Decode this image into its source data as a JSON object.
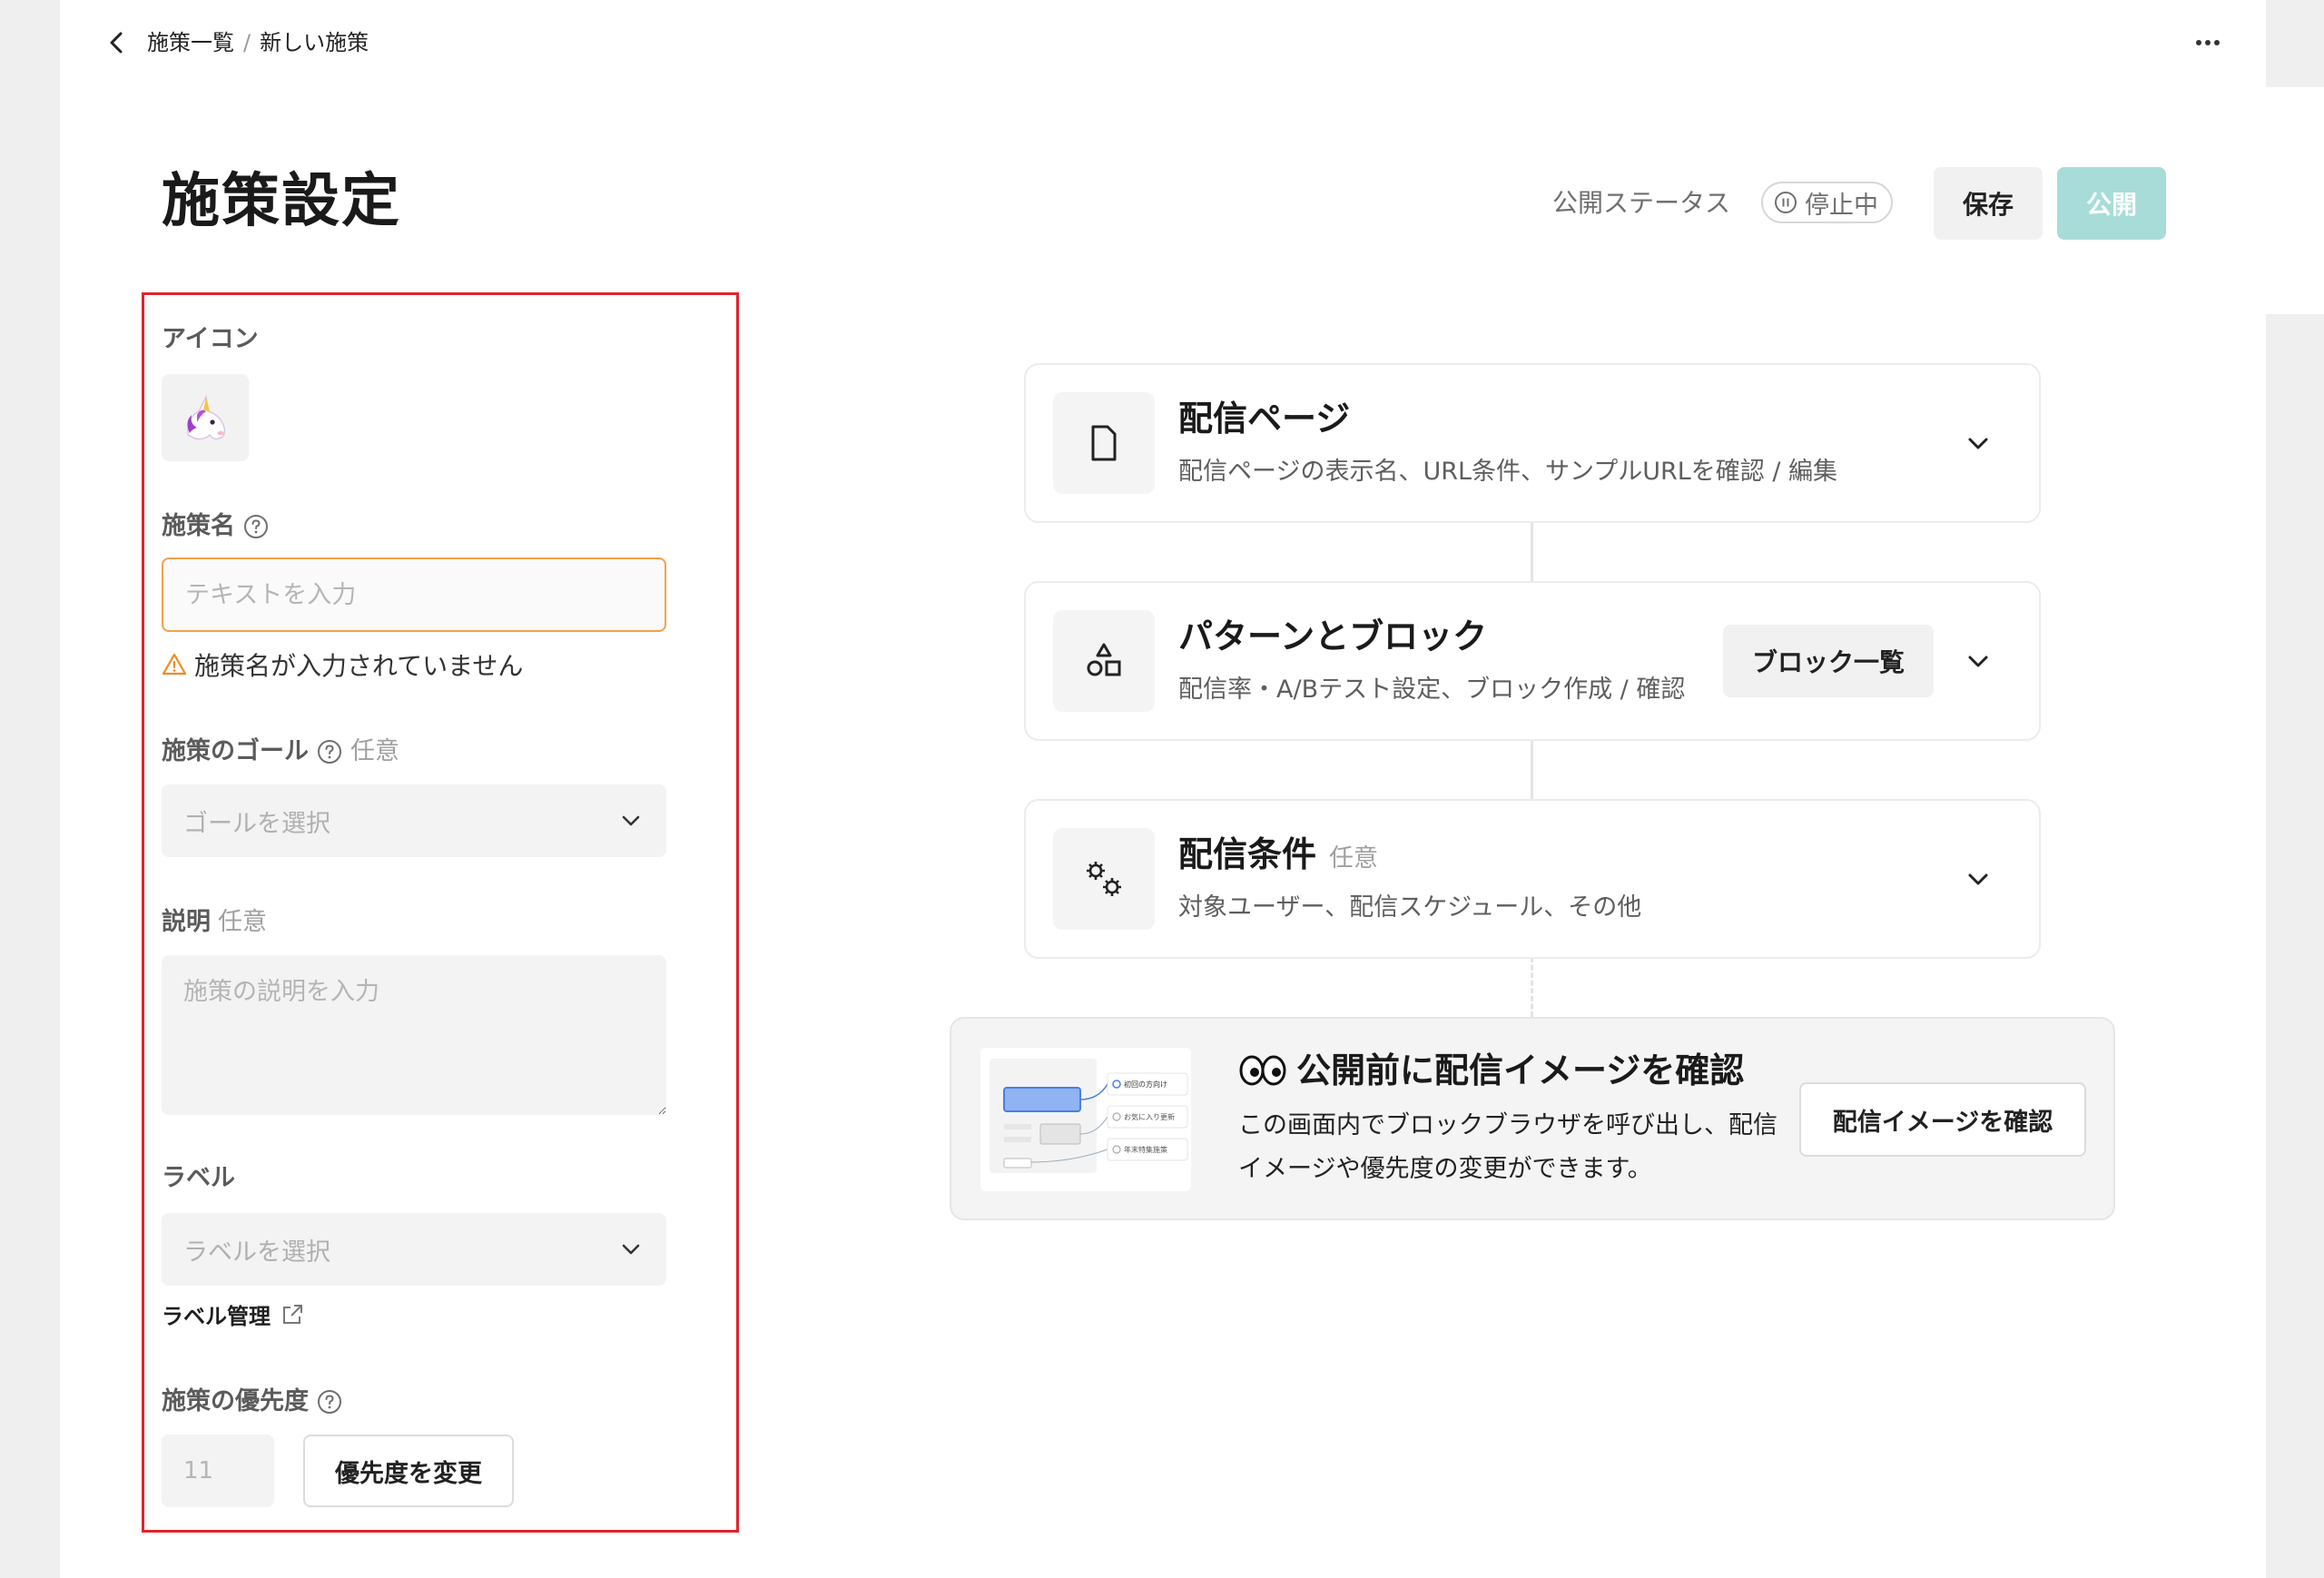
{
  "breadcrumb": {
    "parent": "施策一覧",
    "separator": "/",
    "current": "新しい施策"
  },
  "header": {
    "title": "施策設定",
    "status_label": "公開ステータス",
    "status_value": "停止中",
    "save_label": "保存",
    "publish_label": "公開"
  },
  "form": {
    "icon_label": "アイコン",
    "icon_emoji": "unicorn-icon",
    "name_label": "施策名",
    "name_placeholder": "テキストを入力",
    "name_value": "",
    "name_warning": "施策名が入力されていません",
    "goal_label": "施策のゴール",
    "goal_optional": "任意",
    "goal_placeholder": "ゴールを選択",
    "description_label": "説明",
    "description_optional": "任意",
    "description_placeholder": "施策の説明を入力",
    "label_label": "ラベル",
    "label_placeholder": "ラベルを選択",
    "label_manage": "ラベル管理",
    "priority_label": "施策の優先度",
    "priority_value": "11",
    "priority_button": "優先度を変更"
  },
  "cards": [
    {
      "title": "配信ページ",
      "description": "配信ページの表示名、URL条件、サンプルURLを確認 / 編集",
      "icon": "page-icon"
    },
    {
      "title": "パターンとブロック",
      "description": "配信率・A/Bテスト設定、ブロック作成 / 確認",
      "icon": "shapes-icon",
      "button": "ブロック一覧"
    },
    {
      "title": "配信条件",
      "optional": "任意",
      "description": "対象ユーザー、配信スケジュール、その他",
      "icon": "gears-icon"
    }
  ],
  "preview": {
    "title": "公開前に配信イメージを確認",
    "description": "この画面内でブロックブラウザを呼び出し、配信イメージや優先度の変更ができます。",
    "button": "配信イメージを確認",
    "thumb_items": [
      "初回の方向け",
      "お気に入り更新",
      "年末特集施策"
    ]
  },
  "colors": {
    "accent_disabled": "#a8dcd8",
    "warning": "#f4a14a",
    "highlight_frame": "#e0232b"
  }
}
